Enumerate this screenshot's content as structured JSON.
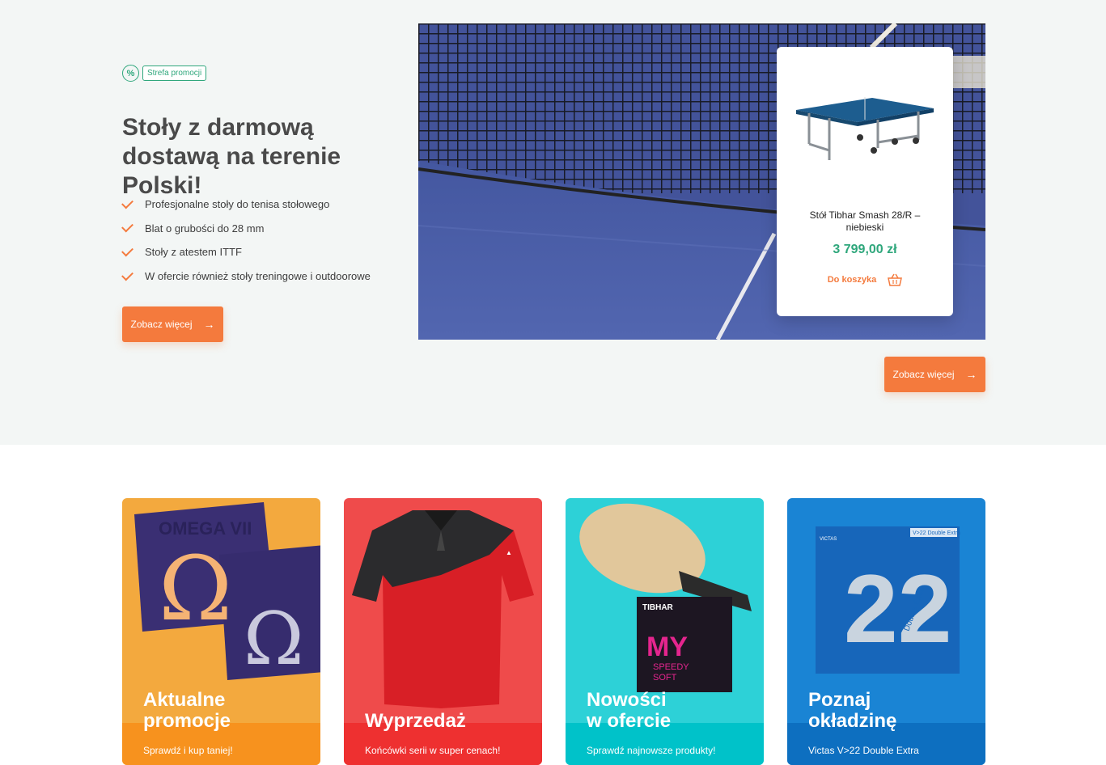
{
  "promo": {
    "icon": "percent-icon",
    "label": "Strefa promocji"
  },
  "hero": {
    "title": "Stoły z darmową dostawą na terenie Polski!",
    "features": [
      "Profesjonalne stoły do tenisa stołowego",
      "Blat o grubości do 28 mm",
      "Stoły z atestem ITTF",
      "W ofercie również stoły treningowe i outdoorowe"
    ],
    "button_label": "Zobacz więcej"
  },
  "product": {
    "name": "Stół Tibhar Smash 28/R – niebieski",
    "price": "3 799,00 zł",
    "cart_label": "Do koszyka",
    "cart_icon": "basket-icon"
  },
  "image_button_label": "Zobacz więcej",
  "categories": [
    {
      "title": "Aktualne\npromocje",
      "subtitle": "Sprawdź i kup taniej!",
      "color": "#f3a93e",
      "band": "#f7921e",
      "art_text": [
        "OMEGA VII",
        "Ω"
      ]
    },
    {
      "title": "Wyprzedaż",
      "subtitle": "Końcówki serii w super cenach!",
      "color": "#ef4b4b",
      "band": "#ee3030"
    },
    {
      "title": "Nowości\nw ofercie",
      "subtitle": "Sprawdź najnowsze produkty!",
      "color": "#2dd1d7",
      "band": "#00c2c9",
      "art_text": [
        "TIBHAR",
        "MY",
        "SPEEDY",
        "SOFT"
      ]
    },
    {
      "title": "Poznaj\nokładzinę",
      "subtitle": "Victas V>22 Double Extra",
      "color": "#1a84d4",
      "band": "#0d6fc0",
      "art_text": [
        "VICTAS",
        "V>22 Double Extra",
        "22",
        "Double Extra"
      ]
    }
  ],
  "colors": {
    "accent": "#f47a3d",
    "green": "#2fa77c",
    "hero_bg": "#f3f6f5"
  }
}
